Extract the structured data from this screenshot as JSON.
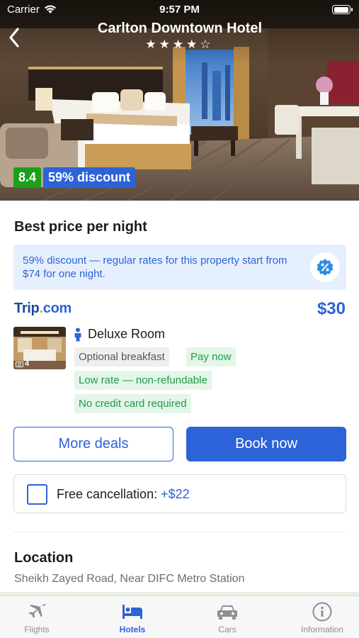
{
  "status_bar": {
    "carrier": "Carrier",
    "time": "9:57 PM"
  },
  "header": {
    "title": "Carlton Downtown Hotel",
    "stars": "★★★★☆",
    "rating_stars": 4,
    "rating_max": 5
  },
  "badges": {
    "score": "8.4",
    "discount": "59% discount"
  },
  "best_price": {
    "title": "Best price per night",
    "info_text": "59% discount — regular rates for this property start from $74 for one night."
  },
  "offer": {
    "provider_name": "Trip",
    "provider_dot": ".",
    "provider_tld": "com",
    "price": "$30",
    "photo_count": "4",
    "room_name": "Deluxe Room",
    "tags": [
      "Optional breakfast",
      "Pay now",
      "Low rate — non-refundable",
      "No credit card required"
    ]
  },
  "buttons": {
    "more_deals": "More deals",
    "book_now": "Book now"
  },
  "cancellation": {
    "label": "Free cancellation:",
    "price": "+$22"
  },
  "location": {
    "title": "Location",
    "address": "Sheikh Zayed Road, Near DIFC Metro Station"
  },
  "tabbar": {
    "tabs": [
      {
        "label": "Flights",
        "icon": "airplane-icon"
      },
      {
        "label": "Hotels",
        "icon": "bed-icon"
      },
      {
        "label": "Cars",
        "icon": "car-icon"
      },
      {
        "label": "Information",
        "icon": "info-icon"
      }
    ],
    "active": "Hotels"
  },
  "colors": {
    "accent": "#2d63d8",
    "score_green": "#1aa01a",
    "tag_green": "#1f9a4a",
    "info_bg": "#e6effd"
  }
}
